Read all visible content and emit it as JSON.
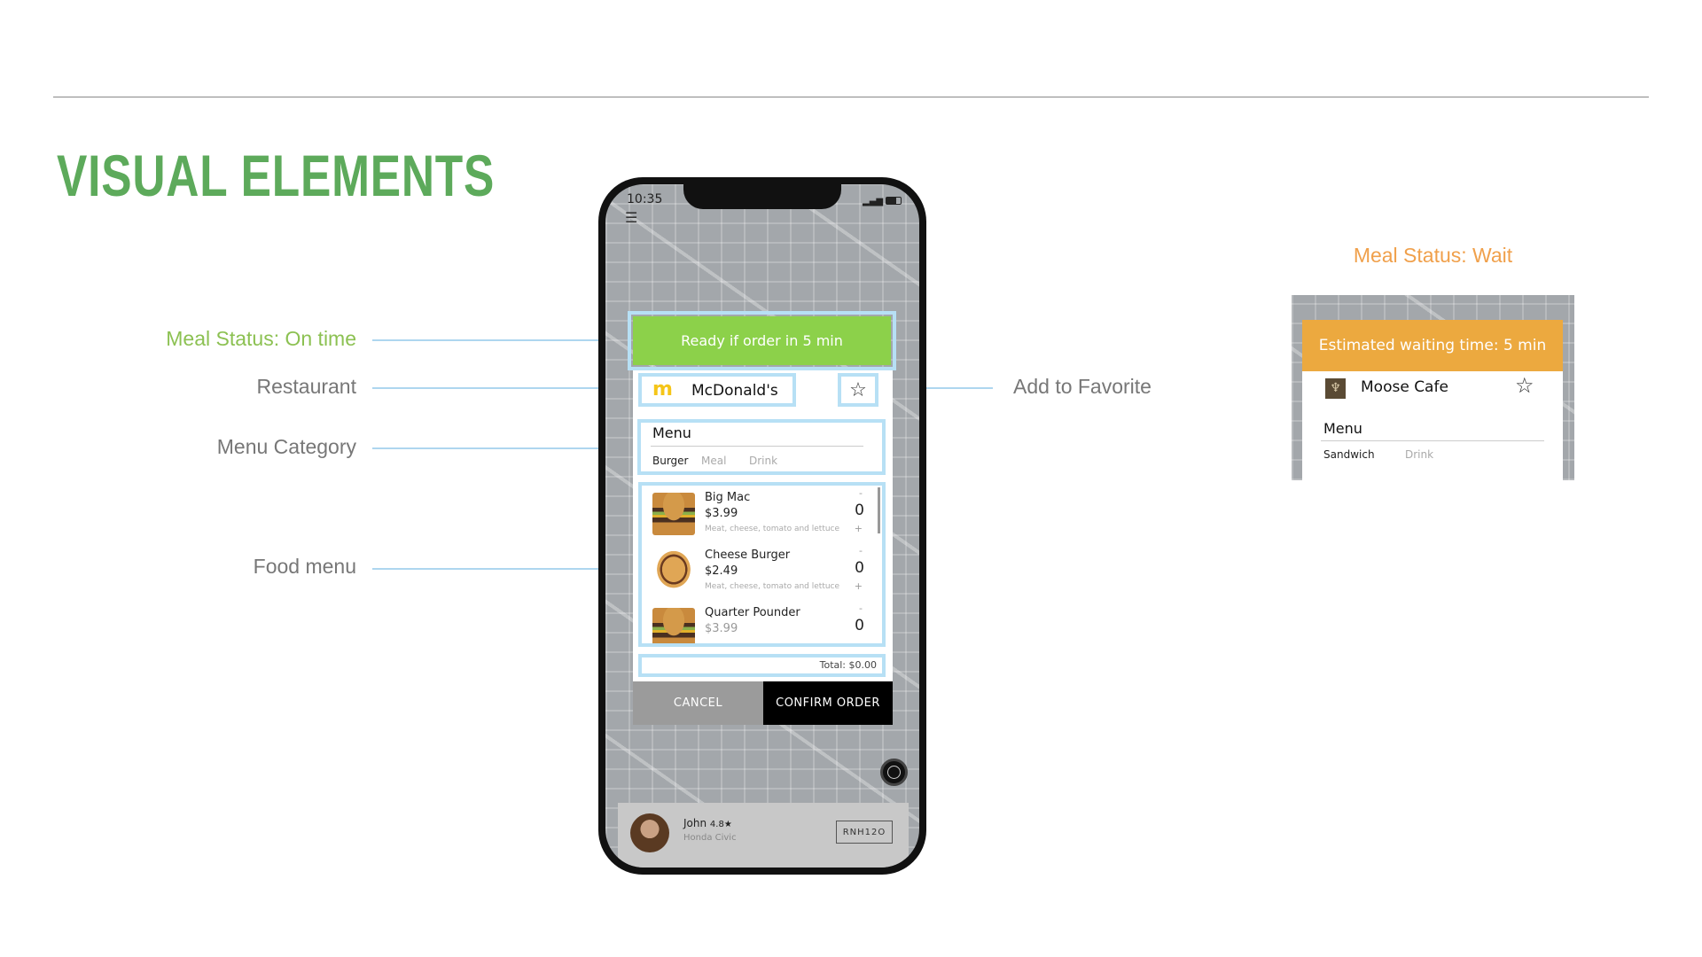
{
  "slide": {
    "title": "VISUAL ELEMENTS"
  },
  "annotations": {
    "meal_status_on_time": "Meal Status: On time",
    "restaurant": "Restaurant",
    "menu_category": "Menu Category",
    "food_menu": "Food menu",
    "add_to_favorite": "Add to Favorite",
    "meal_status_wait": "Meal Status: Wait"
  },
  "colors": {
    "on_time": "#8cd14a",
    "wait": "#eca93f",
    "title": "#5daa5b",
    "highlight": "#b7e0f5"
  },
  "phone": {
    "status_bar": {
      "time": "10:35"
    },
    "banner": "Ready if order in 5 min",
    "restaurant": {
      "name": "McDonald's",
      "logo": "M"
    },
    "menu": {
      "title": "Menu",
      "categories": [
        "Burger",
        "Meal",
        "Drink"
      ],
      "active": "Burger"
    },
    "items": [
      {
        "name": "Big Mac",
        "price": "$3.99",
        "desc": "Meat, cheese, tomato and lettuce",
        "qty": "0"
      },
      {
        "name": "Cheese Burger",
        "price": "$2.49",
        "desc": "Meat, cheese, tomato and lettuce",
        "qty": "0"
      },
      {
        "name": "Quarter Pounder",
        "price": "$3.99",
        "desc": "",
        "qty": "0"
      }
    ],
    "stepper": {
      "minus": "-",
      "plus": "+"
    },
    "total": "Total: $0.00",
    "cancel": "CANCEL",
    "confirm": "CONFIRM ORDER",
    "driver": {
      "name": "John",
      "rating": "4.8★",
      "car": "Honda Civic",
      "plate": "RNH12O"
    }
  },
  "wait_panel": {
    "banner": "Estimated waiting time: 5 min",
    "restaurant": "Moose Cafe",
    "menu_title": "Menu",
    "categories": [
      "Sandwich",
      "Drink"
    ]
  }
}
